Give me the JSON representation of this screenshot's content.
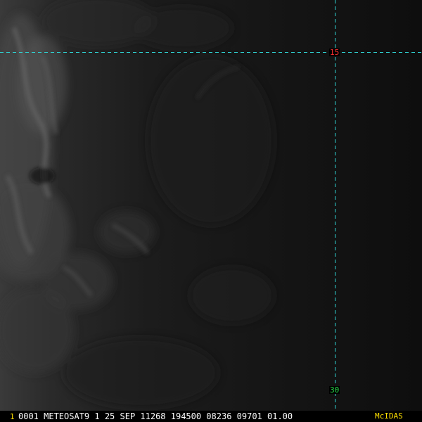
{
  "viewer": {
    "grid": {
      "line_color": "#2fd3d3",
      "labels": [
        {
          "text": "15",
          "color": "#ff3030"
        },
        {
          "text": "30",
          "color": "#27e04a"
        }
      ]
    },
    "status_bar": {
      "frame_number": "1",
      "frame_number_color": "#ffe000",
      "image_info": "0001 METEOSAT9  1 25 SEP 11268 194500 08236 09701 01.00",
      "image_info_color": "#ffffff",
      "software": "McIDAS",
      "software_color": "#ffe000"
    }
  }
}
